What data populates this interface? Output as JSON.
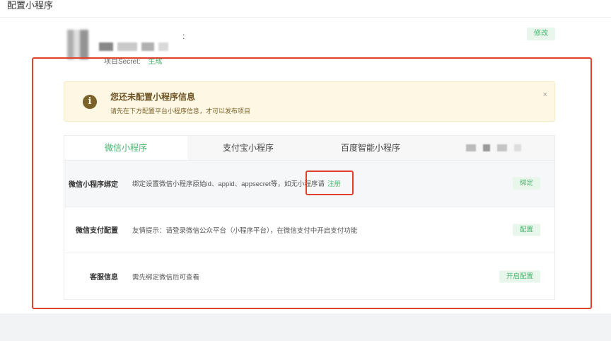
{
  "page": {
    "title": "配置小程序"
  },
  "app_info": {
    "colon": ":",
    "secret_label": "项目Secret:",
    "secret_action": "生成",
    "edit_label": "修改"
  },
  "notice": {
    "icon": "info-icon",
    "title": "您还未配置小程序信息",
    "description": "请先在下方配置平台小程序信息，才可以发布项目",
    "close": "×"
  },
  "tabs": [
    {
      "label": "微信小程序",
      "active": true
    },
    {
      "label": "支付宝小程序",
      "active": false
    },
    {
      "label": "百度智能小程序",
      "active": false
    }
  ],
  "rows": [
    {
      "label": "微信小程序绑定",
      "text": "绑定设置微信小程序原始id、appid、appsecret等，如无小程序请",
      "link": "注册",
      "button": "绑定"
    },
    {
      "label": "微信支付配置",
      "text": "友情提示：请登录微信公众平台（小程序平台），在微信支付中开启支付功能",
      "button": "配置"
    },
    {
      "label": "客服信息",
      "text": "需先绑定微信后可查看",
      "button": "开启配置"
    }
  ],
  "colors": {
    "accent": "#45b36b",
    "highlight_border": "#e0412f",
    "notice_bg": "#fdf7e3"
  }
}
